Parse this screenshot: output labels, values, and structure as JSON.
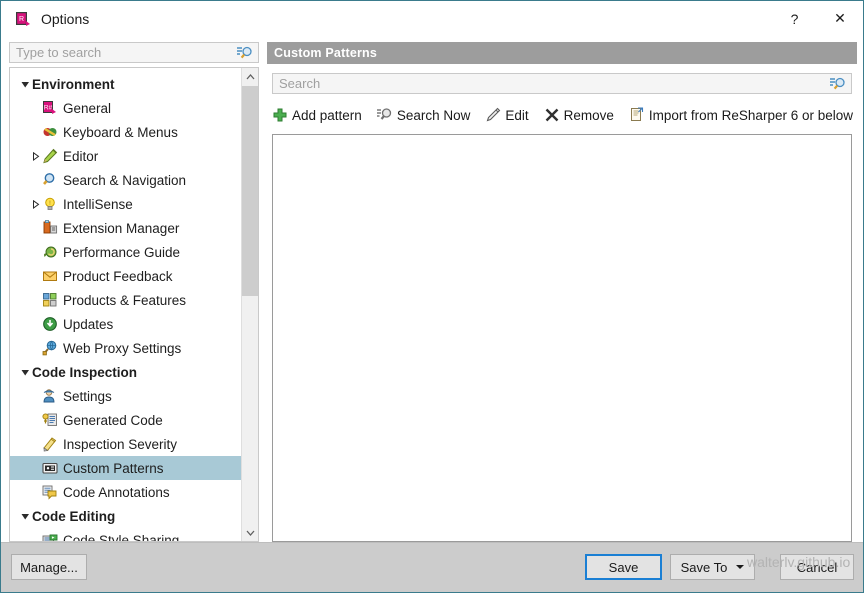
{
  "window": {
    "title": "Options",
    "app_icon": "resharper-icon",
    "help_label": "?",
    "close_label": "✕"
  },
  "sidebar": {
    "search": {
      "placeholder": "Type to search",
      "value": "",
      "icon": "search-icon"
    },
    "items": [
      {
        "label": "Environment",
        "level": 0,
        "icon": "",
        "expander": "expanded",
        "selected": false
      },
      {
        "label": "General",
        "level": 1,
        "icon": "resharper-icon",
        "expander": "none",
        "selected": false
      },
      {
        "label": "Keyboard & Menus",
        "level": 1,
        "icon": "keyboard-menus-icon",
        "expander": "none",
        "selected": false
      },
      {
        "label": "Editor",
        "level": 1,
        "icon": "pencil-icon",
        "expander": "collapsed",
        "selected": false
      },
      {
        "label": "Search & Navigation",
        "level": 1,
        "icon": "magnifier-icon",
        "expander": "none",
        "selected": false
      },
      {
        "label": "IntelliSense",
        "level": 1,
        "icon": "lightbulb-icon",
        "expander": "collapsed",
        "selected": false
      },
      {
        "label": "Extension Manager",
        "level": 1,
        "icon": "extension-icon",
        "expander": "none",
        "selected": false
      },
      {
        "label": "Performance Guide",
        "level": 1,
        "icon": "snail-icon",
        "expander": "none",
        "selected": false
      },
      {
        "label": "Product Feedback",
        "level": 1,
        "icon": "envelope-icon",
        "expander": "none",
        "selected": false
      },
      {
        "label": "Products & Features",
        "level": 1,
        "icon": "blocks-icon",
        "expander": "none",
        "selected": false
      },
      {
        "label": "Updates",
        "level": 1,
        "icon": "update-download-icon",
        "expander": "none",
        "selected": false
      },
      {
        "label": "Web Proxy Settings",
        "level": 1,
        "icon": "globe-plug-icon",
        "expander": "none",
        "selected": false
      },
      {
        "label": "Code Inspection",
        "level": 0,
        "icon": "",
        "expander": "expanded",
        "selected": false
      },
      {
        "label": "Settings",
        "level": 1,
        "icon": "person-settings-icon",
        "expander": "none",
        "selected": false
      },
      {
        "label": "Generated Code",
        "level": 1,
        "icon": "generated-code-icon",
        "expander": "none",
        "selected": false
      },
      {
        "label": "Inspection Severity",
        "level": 1,
        "icon": "severity-icon",
        "expander": "none",
        "selected": false
      },
      {
        "label": "Custom Patterns",
        "level": 1,
        "icon": "custom-patterns-icon",
        "expander": "none",
        "selected": true
      },
      {
        "label": "Code Annotations",
        "level": 1,
        "icon": "annotations-icon",
        "expander": "none",
        "selected": false
      },
      {
        "label": "Code Editing",
        "level": 0,
        "icon": "",
        "expander": "expanded",
        "selected": false
      },
      {
        "label": "Code Style Sharing",
        "level": 1,
        "icon": "code-style-icon",
        "expander": "none",
        "selected": false
      }
    ],
    "scrollbar": {
      "up_icon": "chevron-up-icon",
      "down_icon": "chevron-down-icon"
    }
  },
  "main": {
    "header_title": "Custom Patterns",
    "search": {
      "placeholder": "Search",
      "value": "",
      "icon": "search-icon"
    },
    "toolbar": [
      {
        "label": "Add pattern",
        "icon": "plus-green-icon"
      },
      {
        "label": "Search Now",
        "icon": "magnifier-icon"
      },
      {
        "label": "Edit",
        "icon": "pencil-icon"
      },
      {
        "label": "Remove",
        "icon": "x-cross-icon"
      },
      {
        "label": "Import from ReSharper 6 or below",
        "icon": "import-icon"
      }
    ],
    "list_items": []
  },
  "footer": {
    "manage_label": "Manage...",
    "save_label": "Save",
    "save_to_label": "Save To",
    "save_to_caret": "chevron-down-icon",
    "cancel_label": "Cancel"
  },
  "watermark": {
    "text": "walterlv.github.io"
  },
  "colors": {
    "window_border": "#3a7b8c",
    "pane_header_bg": "#9d9d9d",
    "selection_bg": "#a8c9d6",
    "footer_bg": "#cccccc",
    "accent_focus": "#1a7fd4"
  }
}
